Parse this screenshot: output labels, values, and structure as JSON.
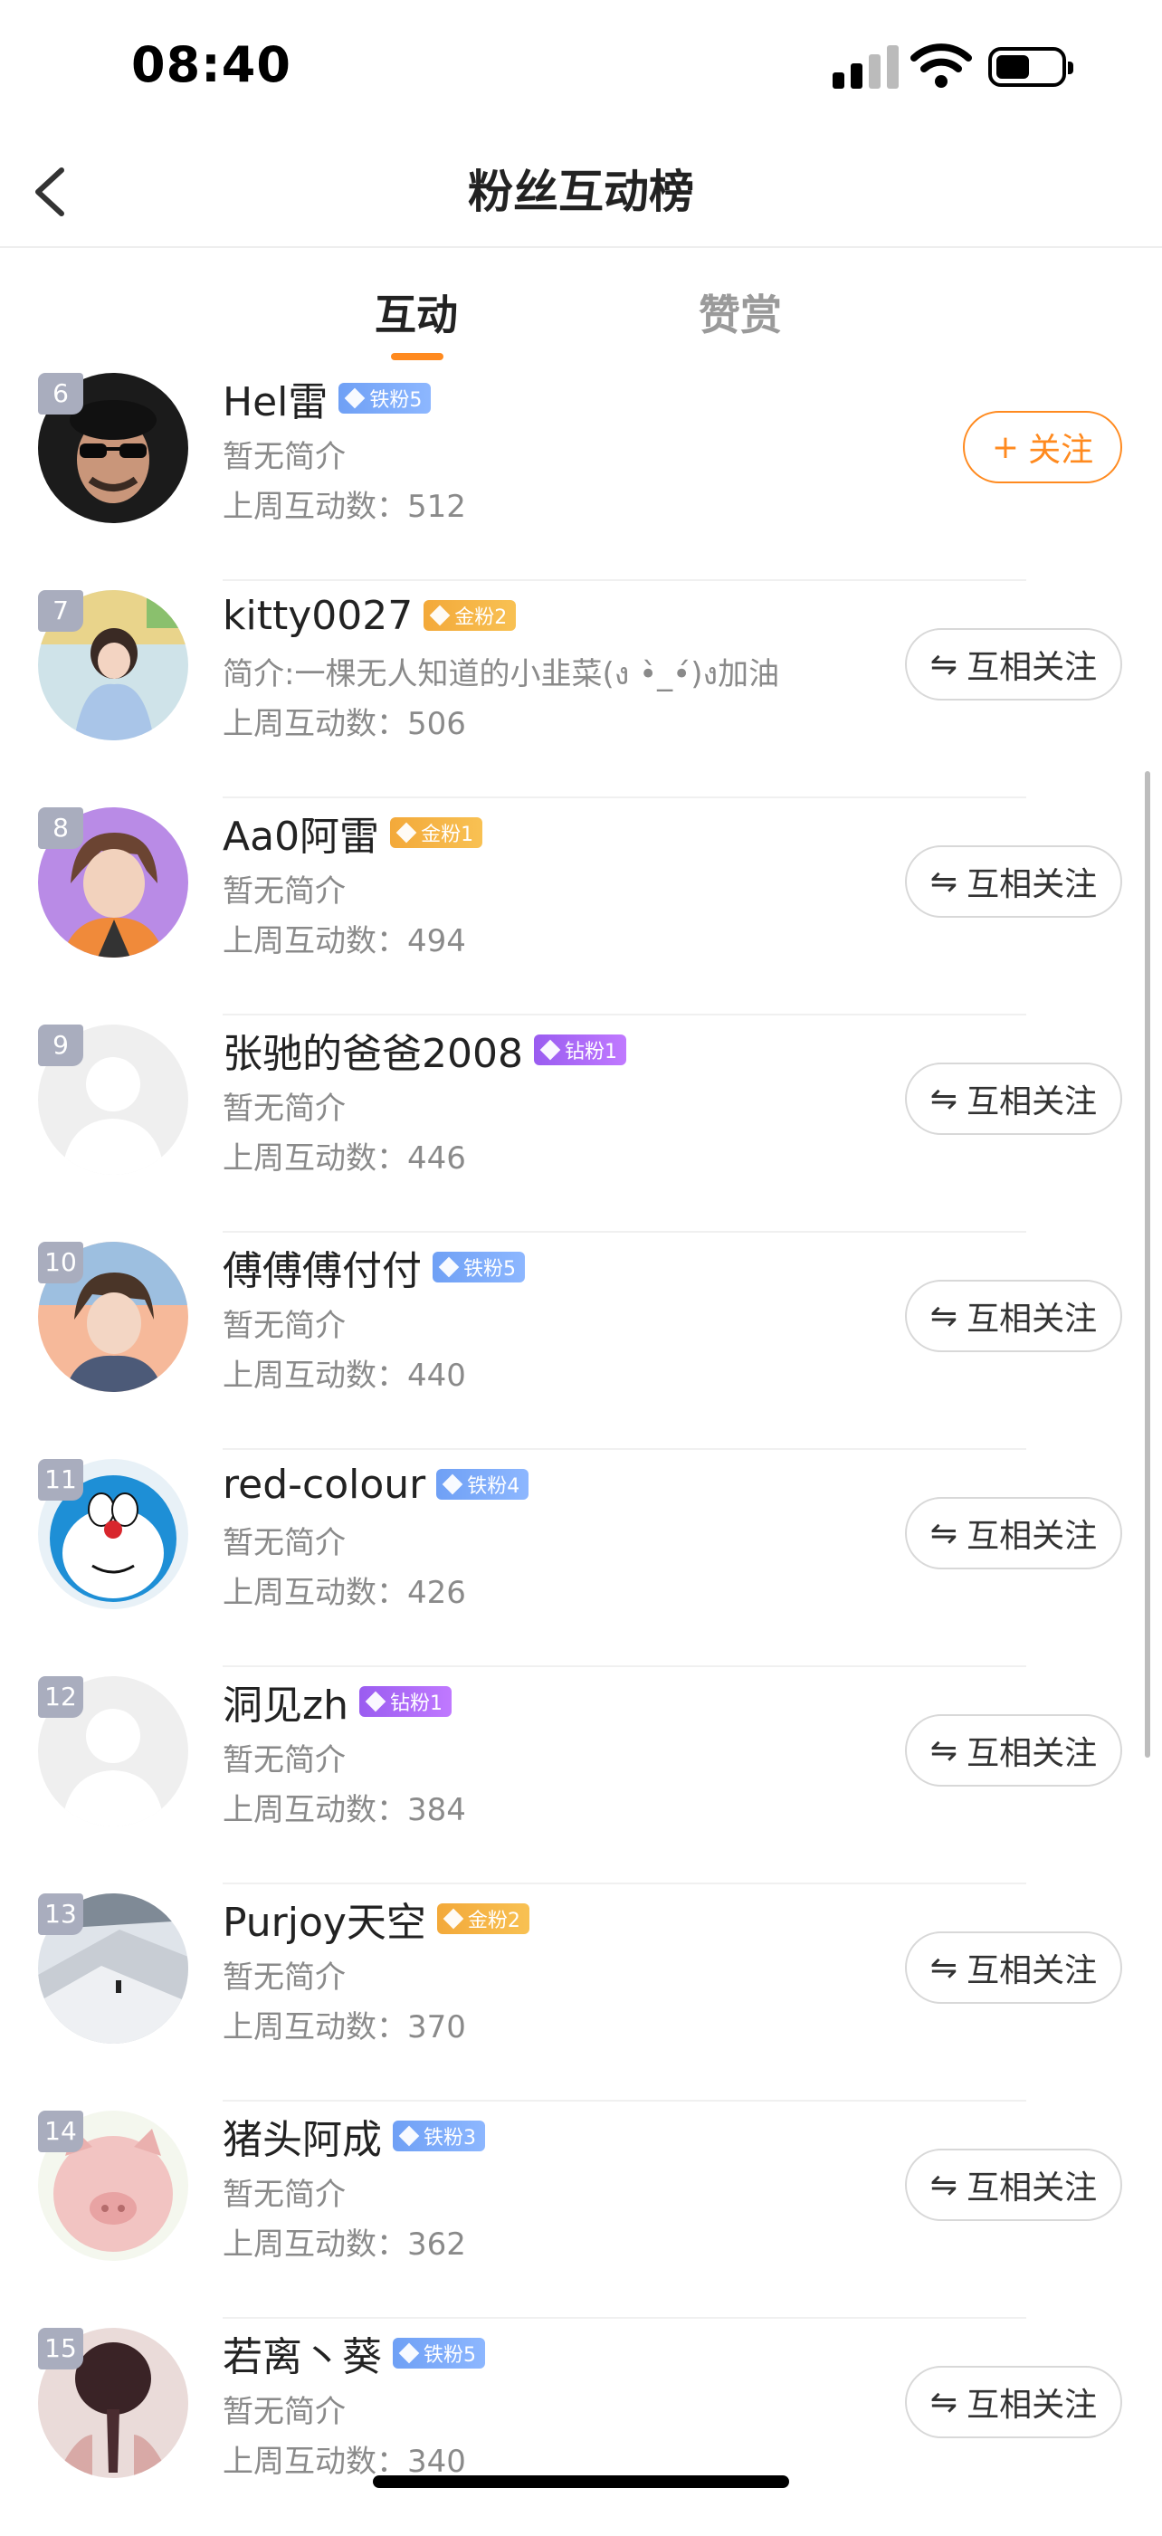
{
  "status": {
    "time": "08:40"
  },
  "nav": {
    "title": "粉丝互动榜"
  },
  "tabs": [
    {
      "label": "互动"
    },
    {
      "label": "赞赏"
    }
  ],
  "colors": {
    "accent": "#ff8a1f",
    "iron": "#7aa8f8",
    "gold": "#f5b445",
    "diamond": "#ad6af7",
    "rank_bg": "#a9adbe"
  },
  "rows": [
    {
      "rank": "6",
      "name": "Hel雷",
      "badge": "铁粉5",
      "badge_tier": "iron",
      "bio": "暂无简介",
      "count": "上周互动数：512",
      "button": "关注",
      "button_symbol": "+",
      "avatar_icon": "sunglasses-man-avatar"
    },
    {
      "rank": "7",
      "name": "kitty0027",
      "badge": "金粉2",
      "badge_tier": "gold",
      "bio": "简介:一棵无人知道的小韭菜(ง •̀_•́)ง加油",
      "count": "上周互动数：506",
      "button": "互相关注",
      "button_symbol": "⇋",
      "avatar_icon": "little-girl-avatar"
    },
    {
      "rank": "8",
      "name": "Aa0阿雷",
      "badge": "金粉1",
      "badge_tier": "gold",
      "bio": "暂无简介",
      "count": "上周互动数：494",
      "button": "互相关注",
      "button_symbol": "⇋",
      "avatar_icon": "anime-boy-avatar"
    },
    {
      "rank": "9",
      "name": "张驰的爸爸2008",
      "badge": "钻粉1",
      "badge_tier": "diamond",
      "bio": "暂无简介",
      "count": "上周互动数：446",
      "button": "互相关注",
      "button_symbol": "⇋",
      "avatar_icon": "default-user-avatar"
    },
    {
      "rank": "10",
      "name": "傅傅傅付付",
      "badge": "铁粉5",
      "badge_tier": "iron",
      "bio": "暂无简介",
      "count": "上周互动数：440",
      "button": "互相关注",
      "button_symbol": "⇋",
      "avatar_icon": "anime-sunset-boy-avatar"
    },
    {
      "rank": "11",
      "name": "red-colour",
      "badge": "铁粉4",
      "badge_tier": "iron",
      "bio": "暂无简介",
      "count": "上周互动数：426",
      "button": "互相关注",
      "button_symbol": "⇋",
      "avatar_icon": "doraemon-avatar"
    },
    {
      "rank": "12",
      "name": "洞见zh",
      "badge": "钻粉1",
      "badge_tier": "diamond",
      "bio": "暂无简介",
      "count": "上周互动数：384",
      "button": "互相关注",
      "button_symbol": "⇋",
      "avatar_icon": "default-user-avatar"
    },
    {
      "rank": "13",
      "name": "Purjoy天空",
      "badge": "金粉2",
      "badge_tier": "gold",
      "bio": "暂无简介",
      "count": "上周互动数：370",
      "button": "互相关注",
      "button_symbol": "⇋",
      "avatar_icon": "snow-mountain-avatar"
    },
    {
      "rank": "14",
      "name": "猪头阿成",
      "badge": "铁粉3",
      "badge_tier": "iron",
      "bio": "暂无简介",
      "count": "上周互动数：362",
      "button": "互相关注",
      "button_symbol": "⇋",
      "avatar_icon": "pig-avatar"
    },
    {
      "rank": "15",
      "name": "若离丶葵",
      "badge": "铁粉5",
      "badge_tier": "iron",
      "bio": "暂无简介",
      "count": "上周互动数：340",
      "button": "互相关注",
      "button_symbol": "⇋",
      "avatar_icon": "braided-hair-avatar"
    }
  ]
}
